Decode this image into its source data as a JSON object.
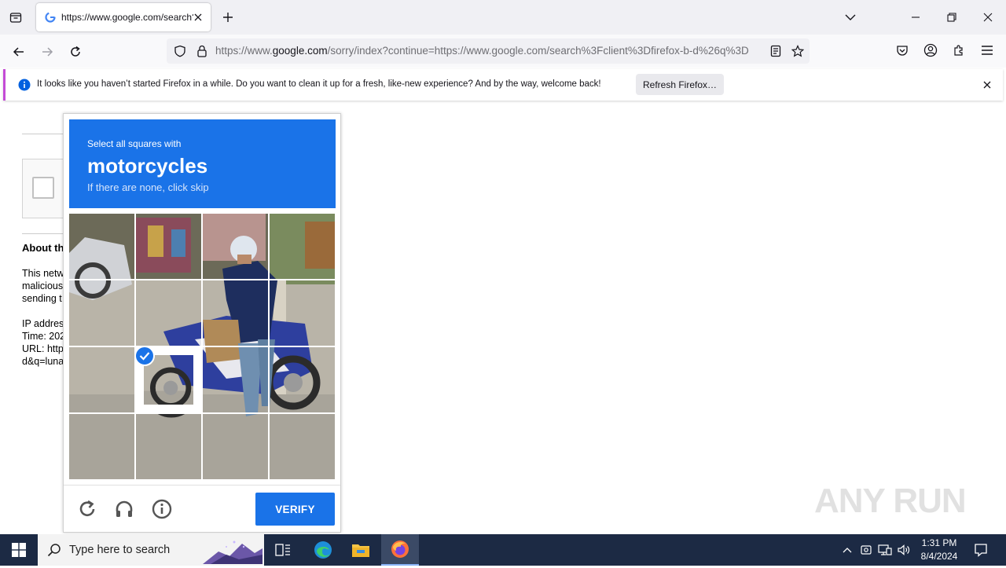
{
  "browser": {
    "tab_title": "https://www.google.com/search?client=firefox-b-d&q=luna",
    "url_prefix": "https://www.",
    "url_domain": "google.com",
    "url_rest": "/sorry/index?continue=https://www.google.com/search%3Fclient%3Dfirefox-b-d%26q%3D",
    "notification_text": "It looks like you haven’t started Firefox in a while. Do you want to clean it up for a fresh, like-new experience? And by the way, welcome back!",
    "notification_button": "Refresh Firefox…"
  },
  "page": {
    "about_title": "About th",
    "body_lines": [
      "This netw",
      "malicious",
      "sending t",
      "",
      "IP addres",
      "Time: 202",
      "URL: http",
      "d&q=luna"
    ]
  },
  "captcha": {
    "instruction_small": "Select all squares with",
    "target": "motorcycles",
    "instruction_sub": "If there are none, click skip",
    "verify_label": "VERIFY",
    "selected_tiles": [
      9
    ]
  },
  "watermark": "ANY RUN",
  "taskbar": {
    "search_placeholder": "Type here to search",
    "time": "1:31 PM",
    "date": "8/4/2024"
  }
}
